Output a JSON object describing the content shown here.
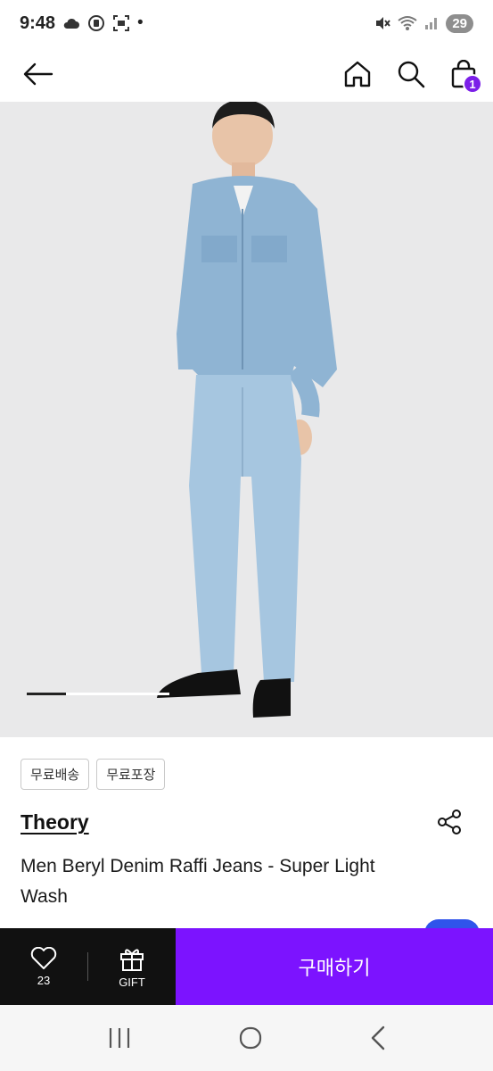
{
  "status_bar": {
    "time": "9:48",
    "dot": "•",
    "battery": "29",
    "icons": [
      "cloud-icon",
      "vpn-icon",
      "screenshot-icon",
      "mute-icon",
      "wifi-icon",
      "signal-icon"
    ]
  },
  "header": {
    "back_icon": "back-arrow-icon",
    "home_icon": "home-icon",
    "search_icon": "search-icon",
    "cart_icon": "shopping-bag-icon",
    "cart_count": "1"
  },
  "colors": {
    "accent": "#7c13ff",
    "badge": "#7b1fe8",
    "dark_bar": "#111111",
    "image_bg": "#e9e9ea"
  },
  "carousel": {
    "active_index": 1,
    "indicator": "first of several images"
  },
  "product": {
    "tags": [
      "무료배송",
      "무료포장"
    ],
    "brand": "Theory",
    "title": "Men Beryl Denim Raffi Jeans - Super Light Wash"
  },
  "action_bar": {
    "like_count": "23",
    "gift_label": "GIFT",
    "buy_label": "구매하기"
  },
  "system_nav": {
    "recents_icon": "recents-icon",
    "home_icon": "home-circle-icon",
    "back_icon": "back-chevron-icon"
  }
}
